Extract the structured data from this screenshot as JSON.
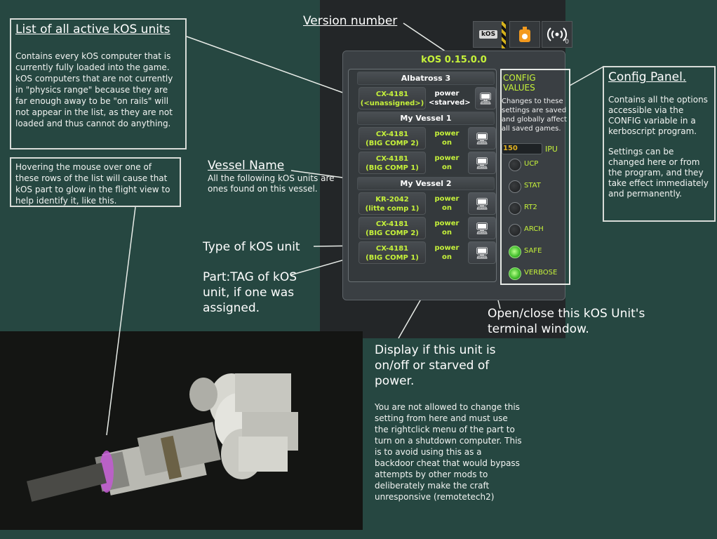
{
  "colors": {
    "background": "#264741",
    "accent_green": "#c6f23a",
    "panel": "#3a3f43",
    "ipu_value": "#e0b020",
    "led_on": "#3fbb2a"
  },
  "toolbar": {
    "icons": [
      {
        "name": "kos-toolbar-icon",
        "label": "kOS"
      },
      {
        "name": "fuel-canister-icon",
        "label": ""
      },
      {
        "name": "antenna-signal-icon",
        "label": "0"
      }
    ]
  },
  "kos_window": {
    "version": "kOS 0.15.0.0",
    "vessels": [
      {
        "name": "Albatross 3",
        "units": [
          {
            "type": "CX-4181",
            "tag": "(<unassigned>)",
            "power": [
              "power",
              "<starved>"
            ]
          }
        ]
      },
      {
        "name": "My Vessel 1",
        "units": [
          {
            "type": "CX-4181",
            "tag": "(BIG COMP 2)",
            "power": [
              "power",
              "on"
            ]
          },
          {
            "type": "CX-4181",
            "tag": "(BIG COMP 1)",
            "power": [
              "power",
              "on"
            ]
          }
        ]
      },
      {
        "name": "My Vessel 2",
        "units": [
          {
            "type": "KR-2042",
            "tag": "(litte comp 1)",
            "power": [
              "power",
              "on"
            ]
          },
          {
            "type": "CX-4181",
            "tag": "(BIG COMP 2)",
            "power": [
              "power",
              "on"
            ]
          },
          {
            "type": "CX-4181",
            "tag": "(BIG COMP 1)",
            "power": [
              "power",
              "on"
            ]
          }
        ]
      }
    ],
    "config": {
      "title": "CONFIG VALUES",
      "description": "Changes to these settings are saved and globally affect all saved games.",
      "ipu_value": "150",
      "ipu_label": "IPU",
      "options": [
        {
          "label": "UCP",
          "enabled": false
        },
        {
          "label": "STAT",
          "enabled": false
        },
        {
          "label": "RT2",
          "enabled": false
        },
        {
          "label": "ARCH",
          "enabled": false
        },
        {
          "label": "SAFE",
          "enabled": true
        },
        {
          "label": "VERBOSE",
          "enabled": true
        }
      ]
    }
  },
  "annotations": {
    "version_number": "Version number",
    "list_title": "List of all active kOS units",
    "list_body": "Contains every kOS computer that is currently fully loaded into the game.  kOS computers that are not currently in \"physics range\" because they are far enough away to be \"on rails\" will not appear in the list, as they are not loaded and thus cannot do anything.",
    "hover_body": "Hovering the mouse over one of these rows of the list will cause that kOS part to glow in the flight view to help identify it, like this.",
    "vessel_name_title": "Vessel Name",
    "vessel_name_body": "All the following kOS units are ones found on this vessel.",
    "type_of_unit": "Type of kOS unit",
    "part_tag": "Part:TAG of kOS unit, if one was assigned.",
    "open_close": "Open/close this kOS Unit's terminal window.",
    "display_title": "Display if this unit is on/off or starved of power.",
    "display_body": "You are not allowed to change this setting from here and must use the rightclick menu of the part to turn on a shutdown computer.  This is to avoid using this as a backdoor cheat that would bypass attempts by other mods to deliberately make the craft unresponsive (remotetech2)",
    "config_title": "Config Panel.",
    "config_body_1": "Contains all the options accessible via the CONFIG variable in a kerboscript program.",
    "config_body_2": "Settings can be changed here or from the program, and they take effect immediately and permanently."
  }
}
